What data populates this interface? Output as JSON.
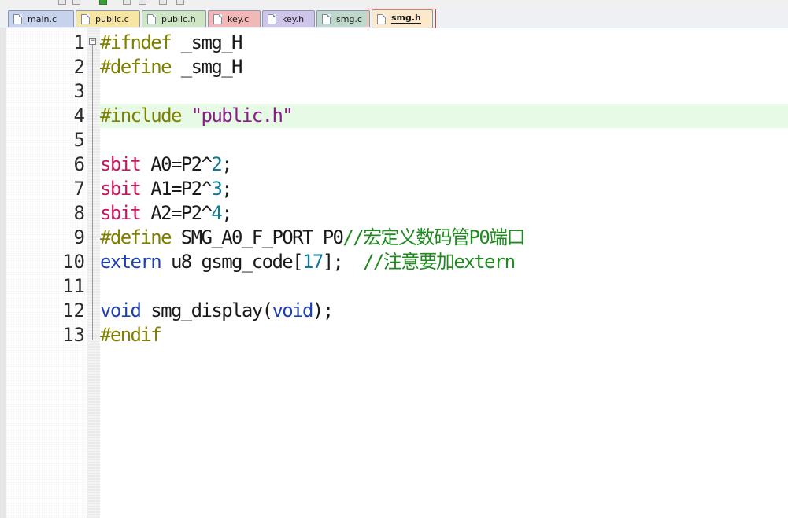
{
  "tabs": [
    {
      "label": "main.c",
      "color": "#c7d3ec"
    },
    {
      "label": "public.c",
      "color": "#f7e6a3"
    },
    {
      "label": "public.h",
      "color": "#cfe6c5"
    },
    {
      "label": "key.c",
      "color": "#f2b8b8"
    },
    {
      "label": "key.h",
      "color": "#cfc4ea"
    },
    {
      "label": "smg.c",
      "color": "#bfd8cc"
    },
    {
      "label": "smg.h",
      "color": "#fde9c9",
      "active": true
    }
  ],
  "editor": {
    "current_line": 4,
    "lines": [
      {
        "n": "1",
        "tokens": [
          {
            "t": "#ifndef",
            "c": "pre"
          },
          {
            "t": " _smg_H",
            "c": "plain"
          }
        ]
      },
      {
        "n": "2",
        "tokens": [
          {
            "t": "#define",
            "c": "pre"
          },
          {
            "t": " _smg_H",
            "c": "plain"
          }
        ]
      },
      {
        "n": "3",
        "tokens": []
      },
      {
        "n": "4",
        "tokens": [
          {
            "t": "#include",
            "c": "pre"
          },
          {
            "t": " ",
            "c": "plain"
          },
          {
            "t": "\"public.h\"",
            "c": "str"
          }
        ]
      },
      {
        "n": "5",
        "tokens": []
      },
      {
        "n": "6",
        "tokens": [
          {
            "t": "sbit",
            "c": "kw"
          },
          {
            "t": " A0=P2^",
            "c": "plain"
          },
          {
            "t": "2",
            "c": "num"
          },
          {
            "t": ";",
            "c": "plain"
          }
        ]
      },
      {
        "n": "7",
        "tokens": [
          {
            "t": "sbit",
            "c": "kw"
          },
          {
            "t": " A1=P2^",
            "c": "plain"
          },
          {
            "t": "3",
            "c": "num"
          },
          {
            "t": ";",
            "c": "plain"
          }
        ]
      },
      {
        "n": "8",
        "tokens": [
          {
            "t": "sbit",
            "c": "kw"
          },
          {
            "t": " A2=P2^",
            "c": "plain"
          },
          {
            "t": "4",
            "c": "num"
          },
          {
            "t": ";",
            "c": "plain"
          }
        ]
      },
      {
        "n": "9",
        "tokens": [
          {
            "t": "#define",
            "c": "pre"
          },
          {
            "t": " SMG_A0_F_PORT P0",
            "c": "plain"
          },
          {
            "t": "//宏定义数码管P0端口",
            "c": "com"
          }
        ]
      },
      {
        "n": "10",
        "tokens": [
          {
            "t": "extern",
            "c": "type"
          },
          {
            "t": " u8 gsmg_code[",
            "c": "plain"
          },
          {
            "t": "17",
            "c": "num"
          },
          {
            "t": "];  ",
            "c": "plain"
          },
          {
            "t": "//注意要加extern",
            "c": "com"
          }
        ]
      },
      {
        "n": "11",
        "tokens": []
      },
      {
        "n": "12",
        "tokens": [
          {
            "t": "void",
            "c": "type"
          },
          {
            "t": " smg_display(",
            "c": "plain"
          },
          {
            "t": "void",
            "c": "type"
          },
          {
            "t": ");",
            "c": "plain"
          }
        ]
      },
      {
        "n": "13",
        "tokens": [
          {
            "t": "#endif",
            "c": "pre"
          }
        ]
      }
    ]
  }
}
